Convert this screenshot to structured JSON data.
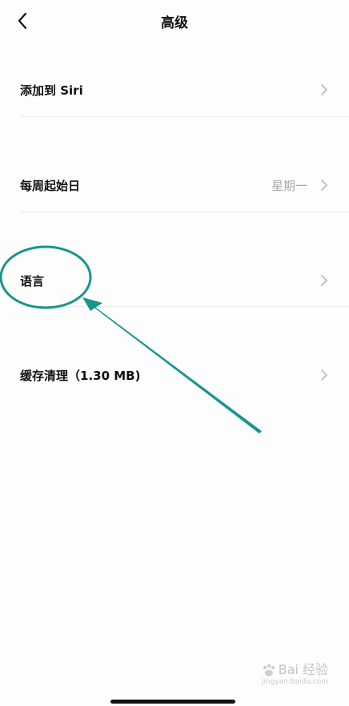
{
  "header": {
    "title": "高级",
    "back_icon": "chevron-left-icon"
  },
  "settings": {
    "items": [
      {
        "label": "添加到 Siri",
        "value": ""
      },
      {
        "label": "每周起始日",
        "value": "星期一"
      },
      {
        "label": "语言",
        "value": ""
      },
      {
        "label": "缓存清理（1.30 MB)",
        "value": ""
      }
    ]
  },
  "annotation": {
    "color": "#17968b",
    "shape": "ellipse-with-arrow",
    "target": "语言"
  },
  "watermark": {
    "text": "Bai 经验",
    "url": "jingyan.baidu.com"
  }
}
